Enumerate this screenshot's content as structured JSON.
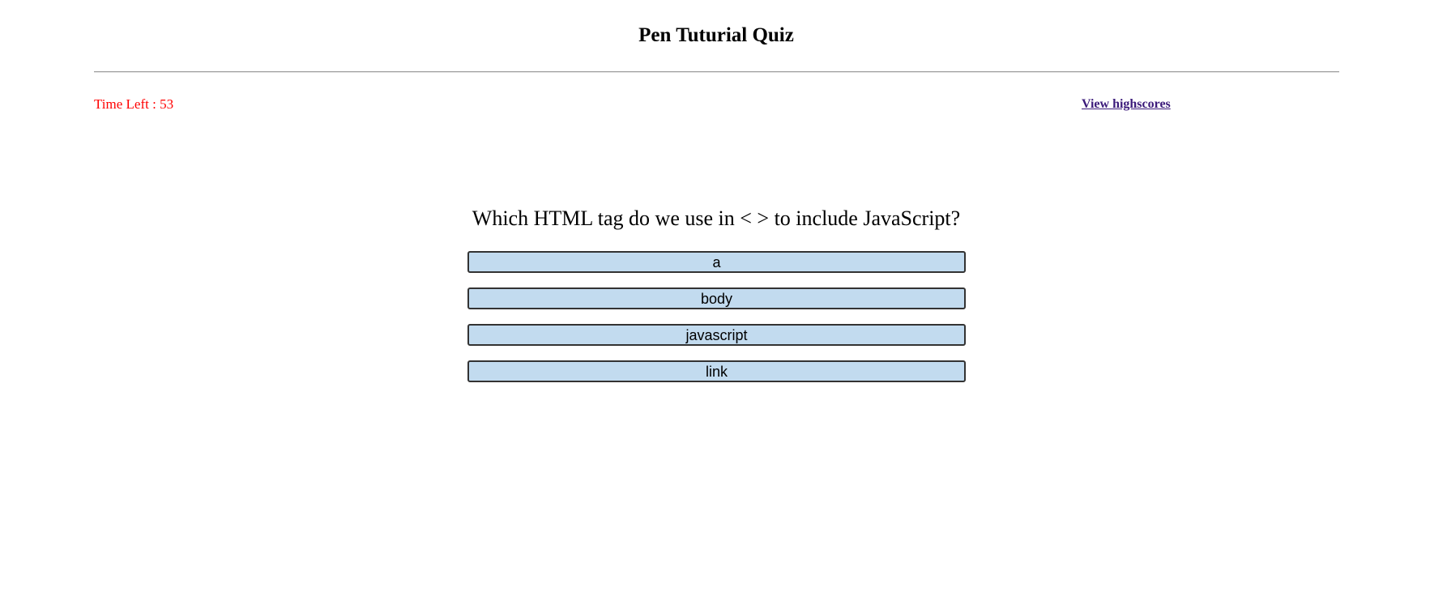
{
  "header": {
    "title": "Pen Tuturial Quiz"
  },
  "status": {
    "timer_label": "Time Left : ",
    "timer_value": "53",
    "highscores_link": "View highscores"
  },
  "quiz": {
    "question": "Which HTML tag do we use in < > to include JavaScript?",
    "answers": [
      "a",
      "body",
      "javascript",
      "link"
    ]
  },
  "colors": {
    "timer": "#ff0000",
    "link": "#3b1a7a",
    "answer_bg": "#c2dbef",
    "answer_border": "#333333"
  }
}
